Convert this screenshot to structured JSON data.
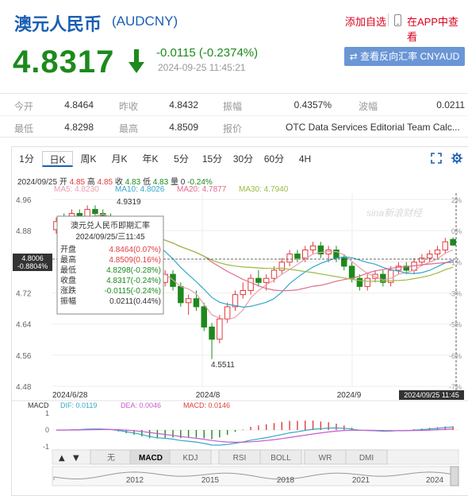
{
  "header": {
    "title": "澳元人民币",
    "code": "(AUDCNY)",
    "add_watch": "添加自选",
    "view_in_app": "在APP中查看"
  },
  "quote": {
    "price": "4.8317",
    "change": "-0.0115 (-0.2374%)",
    "time": "2024-09-25 11:45:21",
    "reverse_button": "查看反向汇率 CNYAUD"
  },
  "stats": {
    "row1": [
      {
        "label": "今开",
        "value": "4.8464"
      },
      {
        "label": "昨收",
        "value": "4.8432"
      },
      {
        "label": "振幅",
        "value": "0.4357%"
      },
      {
        "label": "波幅",
        "value": "0.0211"
      }
    ],
    "row2": [
      {
        "label": "最低",
        "value": "4.8298"
      },
      {
        "label": "最高",
        "value": "4.8509"
      },
      {
        "label": "报价",
        "value": "OTC Data Services Editorial Team Calc..."
      }
    ]
  },
  "tabs": [
    "1分",
    "日K",
    "周K",
    "月K",
    "年K",
    "5分",
    "15分",
    "30分",
    "60分",
    "4H"
  ],
  "active_tab": "日K",
  "info_line": {
    "date": "2024/09/25",
    "open_label": "开",
    "open": "4.85",
    "high_label": "高",
    "high": "4.85",
    "close_label": "收",
    "close": "4.83",
    "low_label": "低",
    "low": "4.83",
    "vol_label": "量",
    "vol": "0",
    "pct": "-0.24%"
  },
  "ma_line": [
    {
      "label": "MA5: 4.8230",
      "color": "#e8a0b0"
    },
    {
      "label": "MA10: 4.8026",
      "color": "#33a8c8"
    },
    {
      "label": "MA20: 4.7877",
      "color": "#e06a8c"
    },
    {
      "label": "MA30: 4.7940",
      "color": "#99bb44"
    }
  ],
  "tooltip": {
    "title": "澳元兑人民币即期汇率",
    "date": "2024/09/25/三11:45",
    "rows": [
      {
        "label": "开盘",
        "value": "4.8464(0.07%)",
        "color": "#e23b3b"
      },
      {
        "label": "最高",
        "value": "4.8509(0.16%)",
        "color": "#e23b3b"
      },
      {
        "label": "最低",
        "value": "4.8298(-0.28%)",
        "color": "#1c8a1c"
      },
      {
        "label": "收盘",
        "value": "4.8317(-0.24%)",
        "color": "#1c8a1c"
      },
      {
        "label": "涨跌",
        "value": "-0.0115(-0.24%)",
        "color": "#1c8a1c"
      },
      {
        "label": "振幅",
        "value": "0.0211(0.44%)",
        "color": "#333333"
      }
    ]
  },
  "chart_data": {
    "type": "candlestick",
    "y_ticks": [
      "4.96",
      "4.88",
      "4.80",
      "4.72",
      "4.64",
      "4.56",
      "4.48"
    ],
    "pct_ticks": [
      "2%",
      "0%",
      "-1%",
      "-3%",
      "-5%",
      "-6%",
      "-7%"
    ],
    "x_ticks": [
      "2024/6/28",
      "2024/8",
      "2024/9"
    ],
    "crosshair_x_label": "2024/09/25 11:45",
    "current_label": "4.8006\n-0.8804%",
    "current_label_line1": "4.8006",
    "current_label_line2": "-0.8804%",
    "high_label": "4.9319",
    "low_label": "4.5511",
    "ylim": [
      4.48,
      4.96
    ],
    "candles": [
      [
        4.87,
        4.9,
        4.86,
        4.89
      ],
      [
        4.89,
        4.91,
        4.87,
        4.88
      ],
      [
        4.88,
        4.92,
        4.87,
        4.91
      ],
      [
        4.91,
        4.92,
        4.89,
        4.9
      ],
      [
        4.9,
        4.93,
        4.89,
        4.92
      ],
      [
        4.92,
        4.93,
        4.9,
        4.91
      ],
      [
        4.91,
        4.92,
        4.89,
        4.9
      ],
      [
        4.9,
        4.91,
        4.87,
        4.88
      ],
      [
        4.88,
        4.89,
        4.84,
        4.85
      ],
      [
        4.85,
        4.86,
        4.81,
        4.82
      ],
      [
        4.82,
        4.84,
        4.79,
        4.8
      ],
      [
        4.8,
        4.81,
        4.76,
        4.77
      ],
      [
        4.77,
        4.78,
        4.72,
        4.73
      ],
      [
        4.73,
        4.75,
        4.7,
        4.74
      ],
      [
        4.74,
        4.77,
        4.73,
        4.76
      ],
      [
        4.76,
        4.77,
        4.72,
        4.73
      ],
      [
        4.73,
        4.74,
        4.68,
        4.69
      ],
      [
        4.69,
        4.71,
        4.66,
        4.7
      ],
      [
        4.7,
        4.72,
        4.67,
        4.68
      ],
      [
        4.68,
        4.69,
        4.62,
        4.63
      ],
      [
        4.63,
        4.64,
        4.551,
        4.6
      ],
      [
        4.6,
        4.66,
        4.59,
        4.65
      ],
      [
        4.65,
        4.69,
        4.64,
        4.68
      ],
      [
        4.68,
        4.72,
        4.67,
        4.71
      ],
      [
        4.71,
        4.74,
        4.7,
        4.72
      ],
      [
        4.72,
        4.76,
        4.71,
        4.75
      ],
      [
        4.75,
        4.77,
        4.73,
        4.74
      ],
      [
        4.74,
        4.76,
        4.72,
        4.75
      ],
      [
        4.75,
        4.78,
        4.74,
        4.77
      ],
      [
        4.77,
        4.8,
        4.76,
        4.79
      ],
      [
        4.79,
        4.82,
        4.78,
        4.81
      ],
      [
        4.81,
        4.82,
        4.79,
        4.8
      ],
      [
        4.8,
        4.83,
        4.79,
        4.82
      ],
      [
        4.82,
        4.84,
        4.81,
        4.83
      ],
      [
        4.83,
        4.84,
        4.8,
        4.81
      ],
      [
        4.81,
        4.83,
        4.79,
        4.82
      ],
      [
        4.82,
        4.83,
        4.79,
        4.8
      ],
      [
        4.8,
        4.81,
        4.77,
        4.78
      ],
      [
        4.78,
        4.79,
        4.74,
        4.75
      ],
      [
        4.75,
        4.76,
        4.72,
        4.73
      ],
      [
        4.73,
        4.76,
        4.72,
        4.75
      ],
      [
        4.75,
        4.77,
        4.74,
        4.76
      ],
      [
        4.76,
        4.77,
        4.73,
        4.74
      ],
      [
        4.74,
        4.78,
        4.73,
        4.77
      ],
      [
        4.77,
        4.79,
        4.76,
        4.78
      ],
      [
        4.78,
        4.79,
        4.76,
        4.77
      ],
      [
        4.77,
        4.8,
        4.76,
        4.79
      ],
      [
        4.79,
        4.81,
        4.78,
        4.8
      ],
      [
        4.8,
        4.82,
        4.79,
        4.81
      ],
      [
        4.81,
        4.83,
        4.8,
        4.82
      ],
      [
        4.82,
        4.85,
        4.81,
        4.84
      ],
      [
        4.846,
        4.851,
        4.83,
        4.832
      ]
    ]
  },
  "macd": {
    "label": "MACD",
    "dif": "DIF: 0.0119",
    "dea": "DEA: 0.0046",
    "macd": "MACD: 0.0146",
    "ticks": [
      "1",
      "0",
      "-1"
    ]
  },
  "indicator_tabs": [
    "无",
    "MACD",
    "KDJ",
    "RSI",
    "BOLL",
    "WR",
    "DMI"
  ],
  "active_indicator": "MACD",
  "timeline_years": [
    "2012",
    "2015",
    "2018",
    "2021",
    "2024"
  ],
  "watermark": "sina新浪财经",
  "colors": {
    "up": "#e23b3b",
    "down": "#1c8a1c",
    "brand": "#1a5fb4"
  }
}
